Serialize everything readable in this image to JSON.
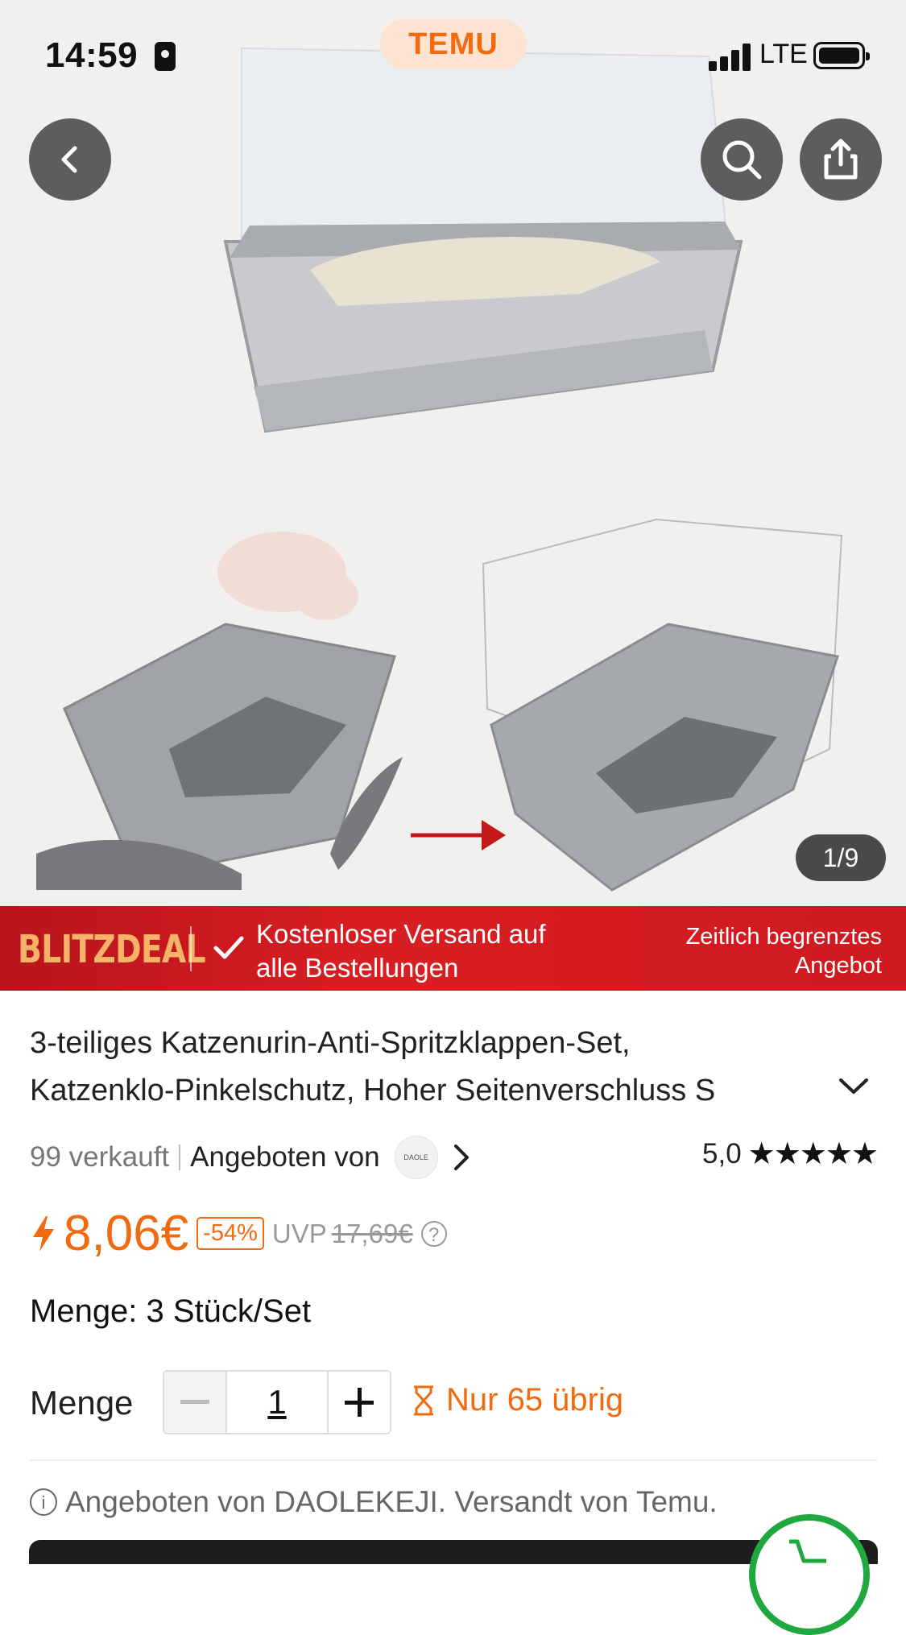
{
  "status_bar": {
    "time": "14:59",
    "network": "LTE"
  },
  "app": {
    "logo_text": "TEMU"
  },
  "gallery": {
    "counter": "1/9"
  },
  "deal_banner": {
    "badge": "BLITZDEAL",
    "shipping_line1": "Kostenloser Versand auf",
    "shipping_line2": "alle Bestellungen",
    "limited_line1": "Zeitlich begrenztes",
    "limited_line2": "Angebot"
  },
  "product": {
    "title_line1": "3-teiliges Katzenurin-Anti-Spritzklappen-Set,",
    "title_line2": "Katzenklo-Pinkelschutz, Hoher Seitenverschluss S",
    "sold": "99 verkauft",
    "offered_by": "Angeboten von",
    "seller_logo": "DAOLE",
    "rating": "5,0",
    "stars": "★★★★★",
    "price": "8,06€",
    "discount": "-54%",
    "uvp_label": "UVP",
    "old_price": "17,69€",
    "variant": "Menge: 3 Stück/Set",
    "qty_label": "Menge",
    "qty_value": "1",
    "stock": "Nur 65 übrig",
    "info": "Angeboten von DAOLEKEJI. Versandt von Temu."
  },
  "colors": {
    "accent": "#f26a0f",
    "deal_red": "#d81e22",
    "cart_green": "#1ea83f"
  }
}
